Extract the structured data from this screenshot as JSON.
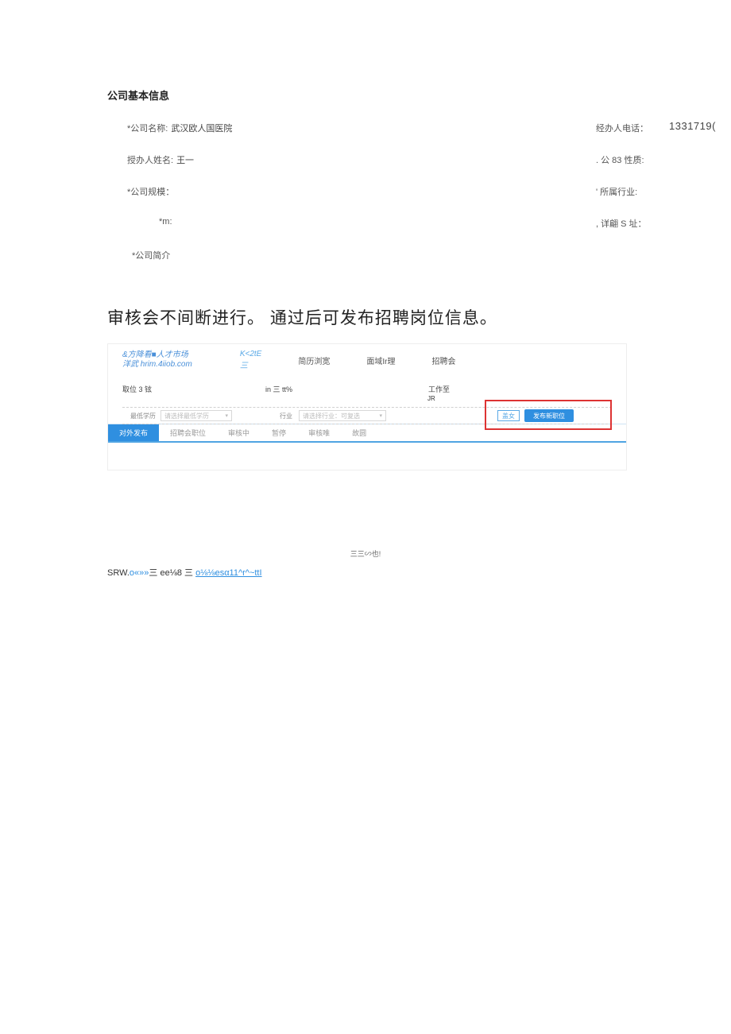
{
  "section1": {
    "title": "公司基本信息",
    "rows": [
      {
        "left_label": "*公司名称:",
        "left_value": "武汉欧人国医院",
        "right_label": "经办人电话：",
        "right_value": "1331719("
      },
      {
        "left_label": "授办人姓名:",
        "left_value": "王一",
        "right_label": ". 公 83 性质:",
        "right_value": ""
      },
      {
        "left_label": "*公司规模：",
        "left_value": "",
        "right_label": "' 所属行业:",
        "right_value": ""
      },
      {
        "left_label": "*m:",
        "left_value": "",
        "right_label": ", 详翩 S 址：",
        "right_value": ""
      },
      {
        "left_label": "*公司简介",
        "left_value": "",
        "right_label": "",
        "right_value": ""
      }
    ]
  },
  "instruction": "审核会不间断进行。  通过后可发布招聘岗位信息。",
  "ui": {
    "brand_line1": "&方降看■人才市场",
    "brand_line2": "洋武 hrim.4iiob.com",
    "nav": {
      "item1": "K<2tE",
      "item1_sub": "三",
      "item2": "简历浏宽",
      "item3": "面域Ir理",
      "item4": "招聘会"
    },
    "filter_headers": {
      "h1": "取位 3 铉",
      "h2": "in 三 tt%",
      "h3": "工作至",
      "h3_sub": "JR"
    },
    "filter_row": {
      "label1": "最低学历",
      "select1_placeholder": "请选择最低学历",
      "label2": "行业",
      "select2_placeholder": "请选择行业：可复选",
      "btn_search": "盖女",
      "btn_publish": "发布新职位"
    },
    "tabs": {
      "t1": "对外发布",
      "t2": "招聘会职位",
      "t3": "审核中",
      "t4": "暂停",
      "t5": "审核唯",
      "t6": "故圆"
    }
  },
  "footer": {
    "center": "三三∽也!",
    "bottom_prefix": "SRW.",
    "bottom_link1": "o«»»",
    "bottom_mid": "三 ee⅛8 三 ",
    "bottom_link2": "o⅛⅛esα11^r^~ttI"
  }
}
